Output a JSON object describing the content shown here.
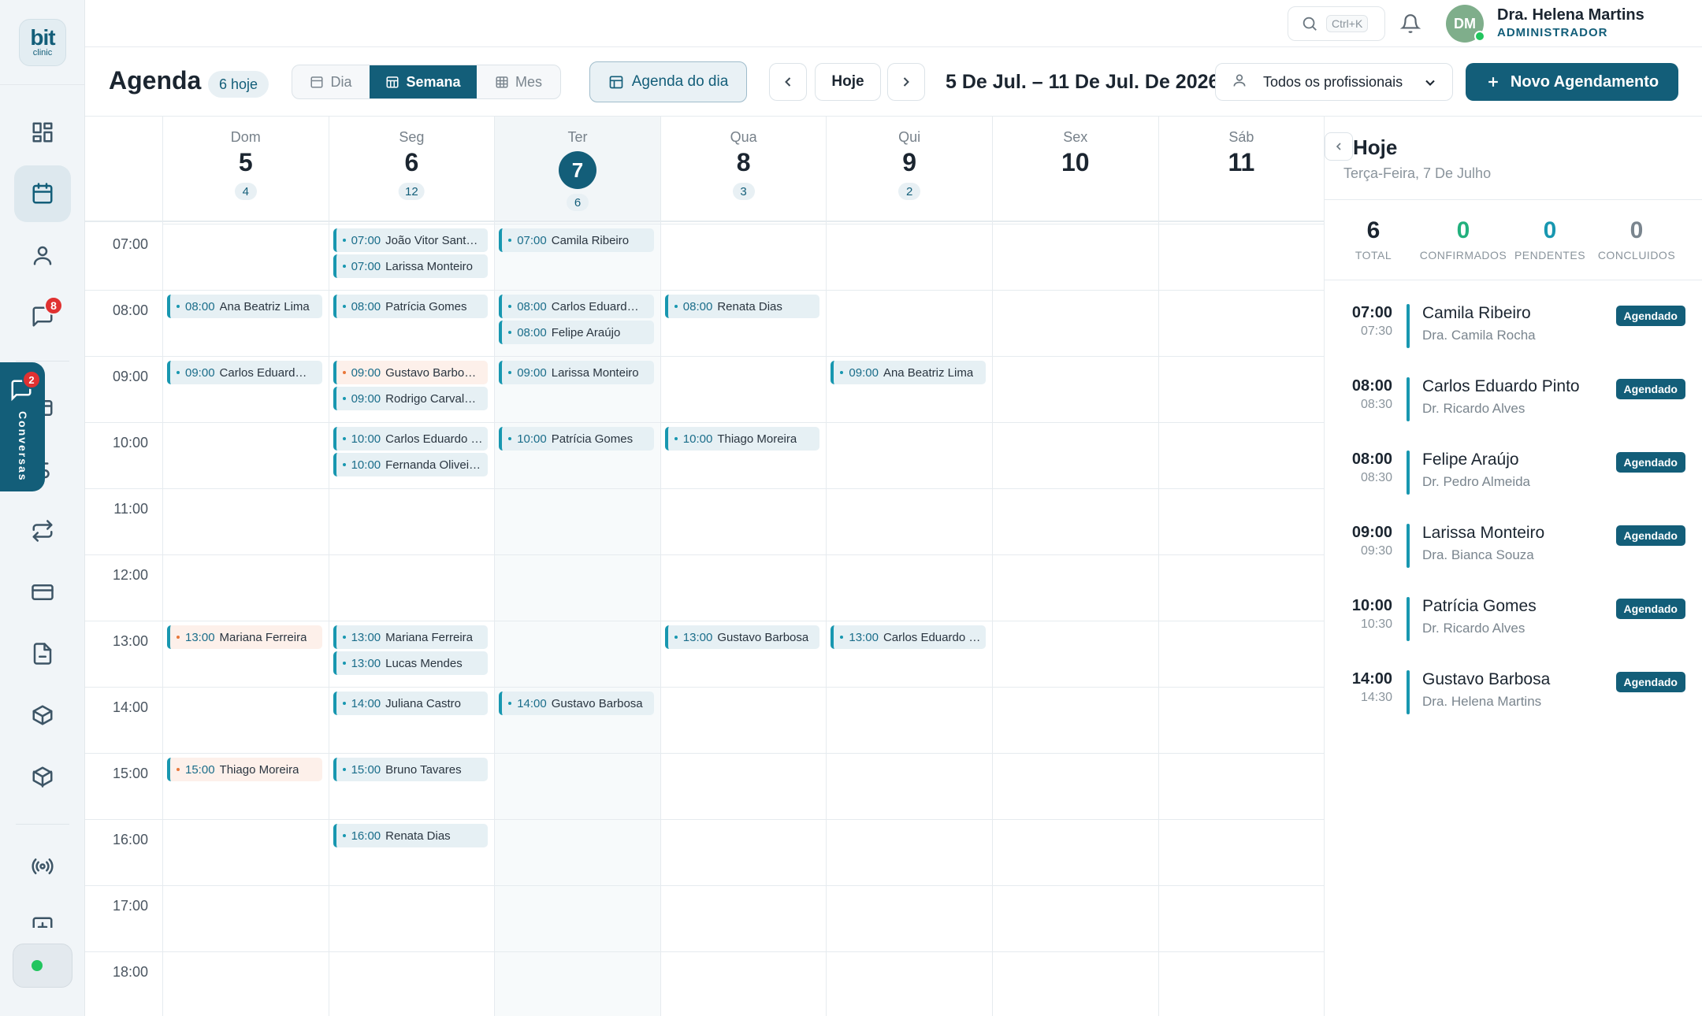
{
  "brand": {
    "logo_top": "bit",
    "logo_bottom": "clinic"
  },
  "sidebar": {
    "items": [
      {
        "name": "dashboard",
        "icon": "dashboard-icon"
      },
      {
        "name": "agenda",
        "icon": "calendar-icon",
        "active": true
      },
      {
        "name": "pacientes",
        "icon": "user-icon"
      },
      {
        "name": "mensagens",
        "icon": "message-icon",
        "badge": "8"
      },
      {
        "name": "financeiro",
        "icon": "wallet-icon"
      },
      {
        "name": "financas",
        "icon": "dollar-icon"
      },
      {
        "name": "transferencias",
        "icon": "repeat-icon"
      },
      {
        "name": "pagamentos",
        "icon": "credit-card-icon"
      },
      {
        "name": "documentos",
        "icon": "file-icon"
      },
      {
        "name": "estoque",
        "icon": "box-icon"
      },
      {
        "name": "produtos",
        "icon": "package-icon"
      },
      {
        "name": "integracoes",
        "icon": "broadcast-icon"
      }
    ],
    "conversas": {
      "label": "Conversas",
      "badge": "2"
    },
    "status_color": "#22c55e"
  },
  "topbar": {
    "search_shortcut": "Ctrl+K",
    "user": {
      "initials": "DM",
      "name": "Dra. Helena Martins",
      "role": "ADMINISTRADOR"
    }
  },
  "toolbar": {
    "title": "Agenda",
    "today_chip": "6 hoje",
    "views": [
      {
        "label": "Dia",
        "active": false
      },
      {
        "label": "Semana",
        "active": true
      },
      {
        "label": "Mes",
        "active": false
      }
    ],
    "agenda_do_dia": "Agenda do dia",
    "hoje": "Hoje",
    "date_range": "5 De Jul. – 11 De Jul. De 2026",
    "professional_filter": "Todos os profissionais",
    "new_button": "Novo Agendamento"
  },
  "calendar": {
    "days": [
      {
        "name": "Dom",
        "num": "5",
        "count": "4"
      },
      {
        "name": "Seg",
        "num": "6",
        "count": "12"
      },
      {
        "name": "Ter",
        "num": "7",
        "count": "6",
        "today": true
      },
      {
        "name": "Qua",
        "num": "8",
        "count": "3"
      },
      {
        "name": "Qui",
        "num": "9",
        "count": "2"
      },
      {
        "name": "Sex",
        "num": "10",
        "count": ""
      },
      {
        "name": "Sáb",
        "num": "11",
        "count": ""
      }
    ],
    "hours": [
      "07:00",
      "08:00",
      "09:00",
      "10:00",
      "11:00",
      "12:00",
      "13:00",
      "14:00",
      "15:00",
      "16:00",
      "17:00",
      "18:00"
    ],
    "events": [
      {
        "day": 1,
        "hour": "07:00",
        "slot": 0,
        "time": "07:00",
        "name": "João Vitor Sant…"
      },
      {
        "day": 1,
        "hour": "07:00",
        "slot": 1,
        "time": "07:00",
        "name": "Larissa Monteiro"
      },
      {
        "day": 2,
        "hour": "07:00",
        "slot": 0,
        "time": "07:00",
        "name": "Camila Ribeiro"
      },
      {
        "day": 0,
        "hour": "08:00",
        "slot": 0,
        "time": "08:00",
        "name": "Ana Beatriz Lima"
      },
      {
        "day": 1,
        "hour": "08:00",
        "slot": 0,
        "time": "08:00",
        "name": "Patrícia Gomes"
      },
      {
        "day": 2,
        "hour": "08:00",
        "slot": 0,
        "time": "08:00",
        "name": "Carlos Eduard…"
      },
      {
        "day": 2,
        "hour": "08:00",
        "slot": 1,
        "time": "08:00",
        "name": "Felipe Araújo"
      },
      {
        "day": 3,
        "hour": "08:00",
        "slot": 0,
        "time": "08:00",
        "name": "Renata Dias"
      },
      {
        "day": 0,
        "hour": "09:00",
        "slot": 0,
        "time": "09:00",
        "name": "Carlos Eduard…"
      },
      {
        "day": 1,
        "hour": "09:00",
        "slot": 0,
        "time": "09:00",
        "name": "Gustavo Barbo…",
        "color": "orange"
      },
      {
        "day": 1,
        "hour": "09:00",
        "slot": 1,
        "time": "09:00",
        "name": "Rodrigo Carval…"
      },
      {
        "day": 2,
        "hour": "09:00",
        "slot": 0,
        "time": "09:00",
        "name": "Larissa Monteiro"
      },
      {
        "day": 4,
        "hour": "09:00",
        "slot": 0,
        "time": "09:00",
        "name": "Ana Beatriz Lima"
      },
      {
        "day": 1,
        "hour": "10:00",
        "slot": 0,
        "time": "10:00",
        "name": "Carlos Eduardo …"
      },
      {
        "day": 1,
        "hour": "10:00",
        "slot": 1,
        "time": "10:00",
        "name": "Fernanda Olivei…"
      },
      {
        "day": 2,
        "hour": "10:00",
        "slot": 0,
        "time": "10:00",
        "name": "Patrícia Gomes"
      },
      {
        "day": 3,
        "hour": "10:00",
        "slot": 0,
        "time": "10:00",
        "name": "Thiago Moreira"
      },
      {
        "day": 0,
        "hour": "13:00",
        "slot": 0,
        "time": "13:00",
        "name": "Mariana Ferreira",
        "color": "orange"
      },
      {
        "day": 1,
        "hour": "13:00",
        "slot": 0,
        "time": "13:00",
        "name": "Mariana Ferreira"
      },
      {
        "day": 1,
        "hour": "13:00",
        "slot": 1,
        "time": "13:00",
        "name": "Lucas Mendes"
      },
      {
        "day": 3,
        "hour": "13:00",
        "slot": 0,
        "time": "13:00",
        "name": "Gustavo Barbosa"
      },
      {
        "day": 4,
        "hour": "13:00",
        "slot": 0,
        "time": "13:00",
        "name": "Carlos Eduardo …"
      },
      {
        "day": 1,
        "hour": "14:00",
        "slot": 0,
        "time": "14:00",
        "name": "Juliana Castro"
      },
      {
        "day": 2,
        "hour": "14:00",
        "slot": 0,
        "time": "14:00",
        "name": "Gustavo Barbosa"
      },
      {
        "day": 0,
        "hour": "15:00",
        "slot": 0,
        "time": "15:00",
        "name": "Thiago Moreira",
        "color": "orange"
      },
      {
        "day": 1,
        "hour": "15:00",
        "slot": 0,
        "time": "15:00",
        "name": "Bruno Tavares"
      },
      {
        "day": 1,
        "hour": "16:00",
        "slot": 0,
        "time": "16:00",
        "name": "Renata Dias"
      }
    ]
  },
  "today_panel": {
    "title": "Hoje",
    "subtitle": "Terça-Feira, 7 De Julho",
    "stats": [
      {
        "value": "6",
        "label": "TOTAL",
        "color": "#1b2530"
      },
      {
        "value": "0",
        "label": "CONFIRMADOS",
        "color": "#22b07d"
      },
      {
        "value": "0",
        "label": "PENDENTES",
        "color": "#1897b0"
      },
      {
        "value": "0",
        "label": "CONCLUIDOS",
        "color": "#7a858e"
      }
    ],
    "appointments": [
      {
        "start": "07:00",
        "end": "07:30",
        "patient": "Camila Ribeiro",
        "doctor": "Dra. Camila Rocha",
        "status": "Agendado"
      },
      {
        "start": "08:00",
        "end": "08:30",
        "patient": "Carlos Eduardo Pinto",
        "doctor": "Dr. Ricardo Alves",
        "status": "Agendado"
      },
      {
        "start": "08:00",
        "end": "08:30",
        "patient": "Felipe Araújo",
        "doctor": "Dr. Pedro Almeida",
        "status": "Agendado"
      },
      {
        "start": "09:00",
        "end": "09:30",
        "patient": "Larissa Monteiro",
        "doctor": "Dra. Bianca Souza",
        "status": "Agendado"
      },
      {
        "start": "10:00",
        "end": "10:30",
        "patient": "Patrícia Gomes",
        "doctor": "Dr. Ricardo Alves",
        "status": "Agendado"
      },
      {
        "start": "14:00",
        "end": "14:30",
        "patient": "Gustavo Barbosa",
        "doctor": "Dra. Helena Martins",
        "status": "Agendado"
      }
    ]
  }
}
